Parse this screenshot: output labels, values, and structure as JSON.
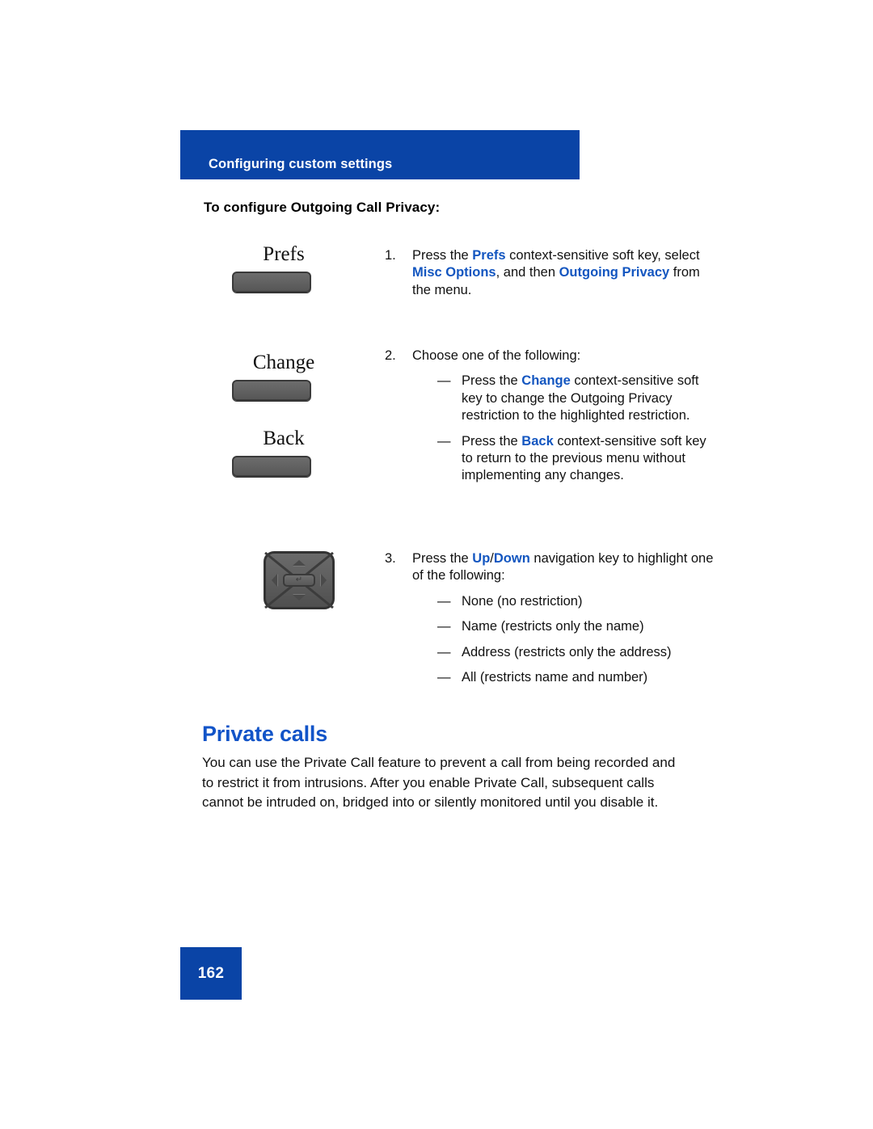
{
  "colors": {
    "banner_blue": "#0a44a6",
    "heading_blue": "#1254c8",
    "inline_blue": "#1356c0",
    "key_gray": "#616161",
    "text_black": "#111111"
  },
  "header": {
    "banner_title": "Configuring custom settings"
  },
  "subheading": "To configure Outgoing Call Privacy:",
  "illustrations": {
    "softkeys": [
      {
        "label": "Prefs",
        "icon": "soft-key-button"
      },
      {
        "label": "Change",
        "icon": "soft-key-button"
      },
      {
        "label": "Back",
        "icon": "soft-key-button"
      }
    ],
    "navigation_key": {
      "icon": "navigation-key",
      "center_glyph": "↵"
    }
  },
  "steps": [
    {
      "number": "1.",
      "parts": [
        {
          "text": "Press the ",
          "style": "normal"
        },
        {
          "text": "Prefs",
          "style": "bold-blue"
        },
        {
          "text": " context-sensitive soft key, select ",
          "style": "normal"
        },
        {
          "text": "Misc Options",
          "style": "bold-blue"
        },
        {
          "text": ", and then ",
          "style": "normal"
        },
        {
          "text": "Outgoing Privacy",
          "style": "bold-blue"
        },
        {
          "text": " from the menu.",
          "style": "normal"
        }
      ],
      "sub_items": []
    },
    {
      "number": "2.",
      "parts": [
        {
          "text": "Choose one of the following:",
          "style": "normal"
        }
      ],
      "sub_items": [
        {
          "dash": "—",
          "parts": [
            {
              "text": "Press the ",
              "style": "normal"
            },
            {
              "text": "Change",
              "style": "bold-blue"
            },
            {
              "text": " context-sensitive soft key to change the Outgoing Privacy restriction to the highlighted restriction.",
              "style": "normal"
            }
          ]
        },
        {
          "dash": "—",
          "parts": [
            {
              "text": "Press the ",
              "style": "normal"
            },
            {
              "text": "Back",
              "style": "bold-blue"
            },
            {
              "text": " context-sensitive soft key to return to the previous menu without implementing any changes.",
              "style": "normal"
            }
          ]
        }
      ]
    },
    {
      "number": "3.",
      "parts": [
        {
          "text": "Press the ",
          "style": "normal"
        },
        {
          "text": "Up",
          "style": "bold-blue"
        },
        {
          "text": "/",
          "style": "normal"
        },
        {
          "text": "Down",
          "style": "bold-blue"
        },
        {
          "text": " navigation key to highlight one of the following:",
          "style": "normal"
        }
      ],
      "sub_items": [
        {
          "dash": "—",
          "parts": [
            {
              "text": "None (no restriction)",
              "style": "normal"
            }
          ]
        },
        {
          "dash": "—",
          "parts": [
            {
              "text": "Name (restricts only the name)",
              "style": "normal"
            }
          ]
        },
        {
          "dash": "—",
          "parts": [
            {
              "text": "Address (restricts only the address)",
              "style": "normal"
            }
          ]
        },
        {
          "dash": "—",
          "parts": [
            {
              "text": "All (restricts name and number)",
              "style": "normal"
            }
          ]
        }
      ]
    }
  ],
  "section": {
    "heading": "Private calls",
    "paragraph": "You can use the Private Call feature to prevent a call from being recorded and to restrict it from intrusions. After you enable Private Call, subsequent calls cannot be intruded on, bridged into or silently monitored until you disable it."
  },
  "footer": {
    "page_number": "162"
  }
}
